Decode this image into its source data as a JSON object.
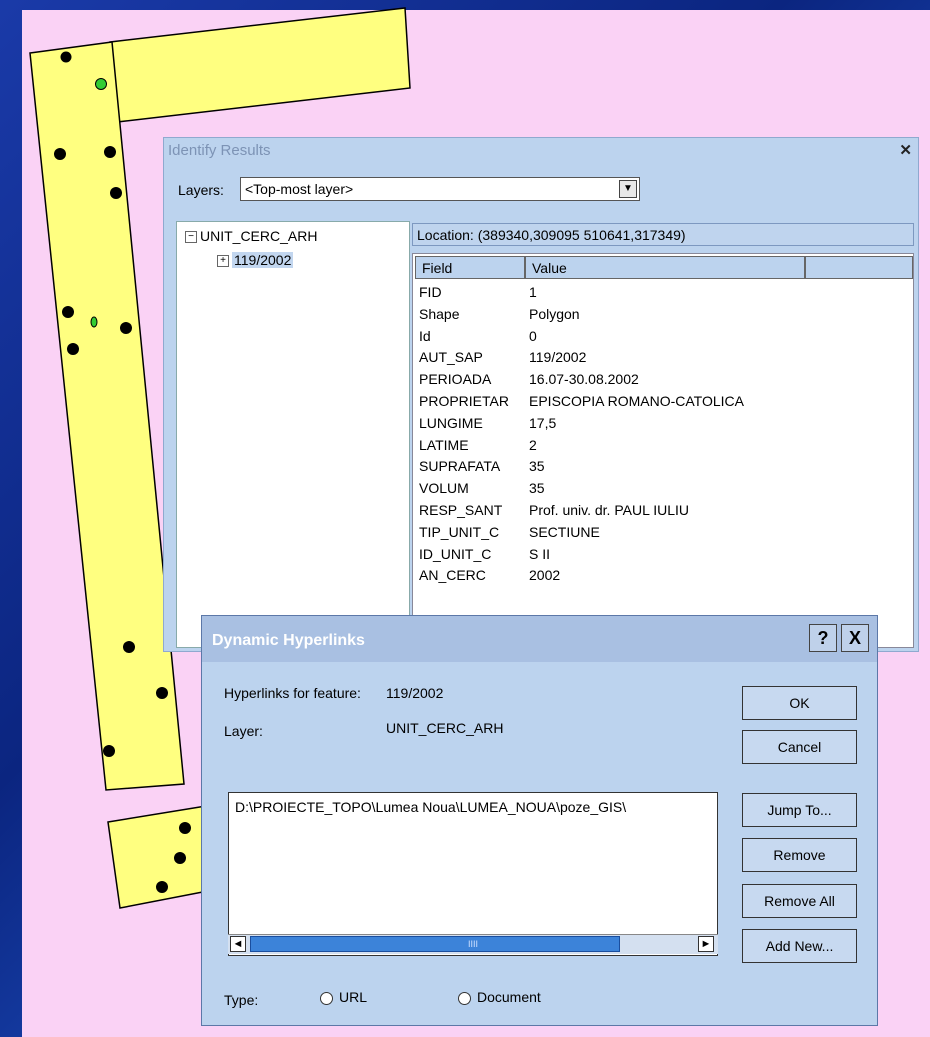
{
  "colors": {
    "pink_bg": "#fad2f5",
    "parcel_fill": "#ffff80",
    "dot": "#000000",
    "green_dot": "#33cc33"
  },
  "identify": {
    "title": "Identify Results",
    "close_icon": "close-icon",
    "layers_label": "Layers:",
    "layers_value": "<Top-most layer>",
    "tree": {
      "root": "UNIT_CERC_ARH",
      "child": "119/2002"
    },
    "location": "Location: (389340,309095 510641,317349)",
    "columns": [
      "Field",
      "Value"
    ],
    "rows": [
      {
        "field": "FID",
        "value": "1"
      },
      {
        "field": "Shape",
        "value": "Polygon"
      },
      {
        "field": "Id",
        "value": "0"
      },
      {
        "field": "AUT_SAP",
        "value": "119/2002"
      },
      {
        "field": "PERIOADA",
        "value": "16.07-30.08.2002"
      },
      {
        "field": "PROPRIETAR",
        "value": "EPISCOPIA ROMANO-CATOLICA"
      },
      {
        "field": "LUNGIME",
        "value": "17,5"
      },
      {
        "field": "LATIME",
        "value": "2"
      },
      {
        "field": "SUPRAFATA",
        "value": "35"
      },
      {
        "field": "VOLUM",
        "value": "35"
      },
      {
        "field": "RESP_SANT",
        "value": "Prof. univ. dr. PAUL IULIU"
      },
      {
        "field": "TIP_UNIT_C",
        "value": "SECTIUNE"
      },
      {
        "field": "ID_UNIT_C",
        "value": "S II"
      },
      {
        "field": "AN_CERC",
        "value": "2002"
      }
    ]
  },
  "dialog": {
    "title": "Dynamic Hyperlinks",
    "help": "?",
    "close": "X",
    "feature_label": "Hyperlinks for feature:",
    "feature_value": "119/2002",
    "layer_label": "Layer:",
    "layer_value": "UNIT_CERC_ARH",
    "link": "D:\\PROIECTE_TOPO\\Lumea Noua\\LUMEA_NOUA\\poze_GIS\\",
    "scroll_grip": "IIII",
    "buttons": {
      "ok": "OK",
      "cancel": "Cancel",
      "jump": "Jump To...",
      "remove": "Remove",
      "remove_all": "Remove All",
      "add_new": "Add New..."
    },
    "type_label": "Type:",
    "type_url": "URL",
    "type_document": "Document"
  }
}
